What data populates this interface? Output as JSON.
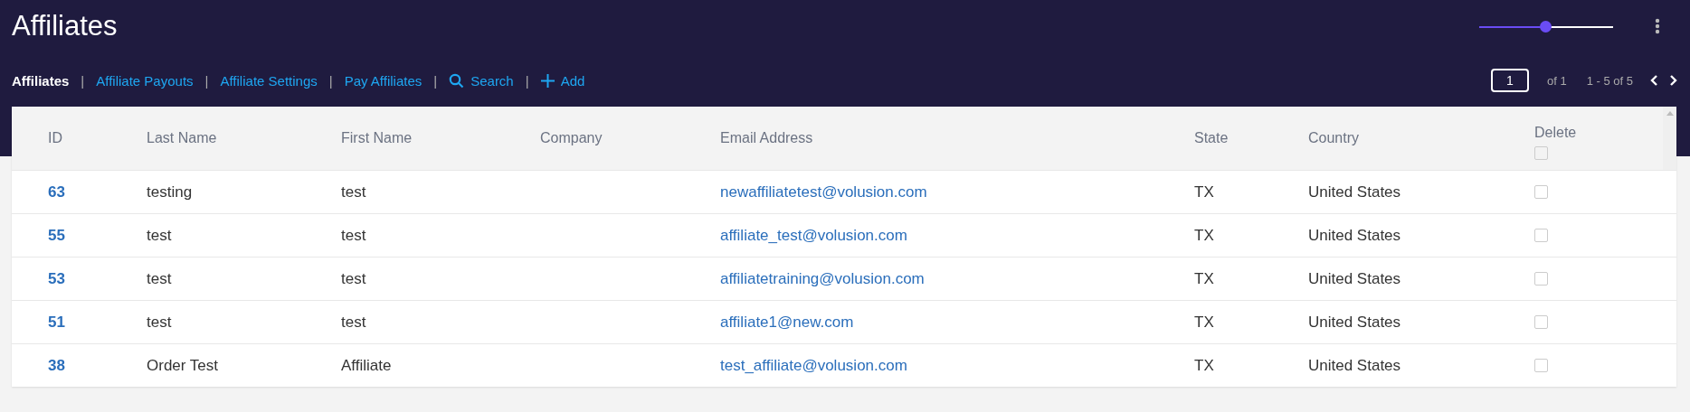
{
  "page": {
    "title": "Affiliates"
  },
  "zoom_slider": {
    "level": 0.5
  },
  "nav": [
    {
      "label": "Affiliates",
      "selected": true,
      "kind": "plain"
    },
    {
      "label": "Affiliate Payouts",
      "selected": false,
      "kind": "plain"
    },
    {
      "label": "Affiliate Settings",
      "selected": false,
      "kind": "plain"
    },
    {
      "label": "Pay Affiliates",
      "selected": false,
      "kind": "plain"
    },
    {
      "label": "Search",
      "selected": false,
      "kind": "search"
    },
    {
      "label": "Add",
      "selected": false,
      "kind": "add"
    }
  ],
  "nav_separator": "|",
  "pagination": {
    "page": "1",
    "of_pages": "of 1",
    "range": "1 - 5 of 5"
  },
  "table": {
    "columns": [
      "ID",
      "Last Name",
      "First Name",
      "Company",
      "Email Address",
      "State",
      "Country",
      "Delete"
    ],
    "select_all_checked": false,
    "rows": [
      {
        "id": "63",
        "last_name": "testing",
        "first_name": "test",
        "email": "newaffiliatetest@volusion.com",
        "state": "TX",
        "country": "United States",
        "checked": false
      },
      {
        "id": "55",
        "last_name": "test",
        "first_name": "test",
        "email": "affiliate_test@volusion.com",
        "state": "TX",
        "country": "United States",
        "checked": false
      },
      {
        "id": "53",
        "last_name": "test",
        "first_name": "test",
        "email": "affiliatetraining@volusion.com",
        "state": "TX",
        "country": "United States",
        "checked": false
      },
      {
        "id": "51",
        "last_name": "test",
        "first_name": "test",
        "email": "affiliate1@new.com",
        "state": "TX",
        "country": "United States",
        "checked": false
      },
      {
        "id": "38",
        "last_name": "Order Test",
        "first_name": "Affiliate",
        "email": "test_affiliate@volusion.com",
        "state": "TX",
        "country": "United States",
        "checked": false
      }
    ]
  }
}
